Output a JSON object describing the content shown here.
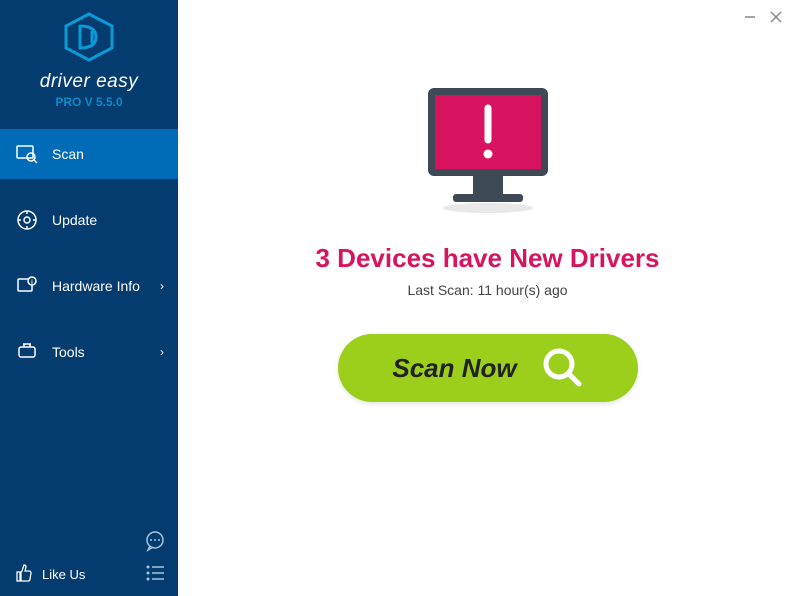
{
  "brand": "driver easy",
  "version": "PRO V 5.5.0",
  "nav": {
    "scan": "Scan",
    "update": "Update",
    "hardware": "Hardware Info",
    "tools": "Tools"
  },
  "likeus": "Like Us",
  "main": {
    "headline": "3 Devices have New Drivers",
    "subtext": "Last Scan: 11 hour(s) ago",
    "scan_label": "Scan Now"
  },
  "colors": {
    "sidebar": "#043c6f",
    "active": "#006cb7",
    "accent": "#d8135f",
    "button": "#9ccf1b"
  }
}
